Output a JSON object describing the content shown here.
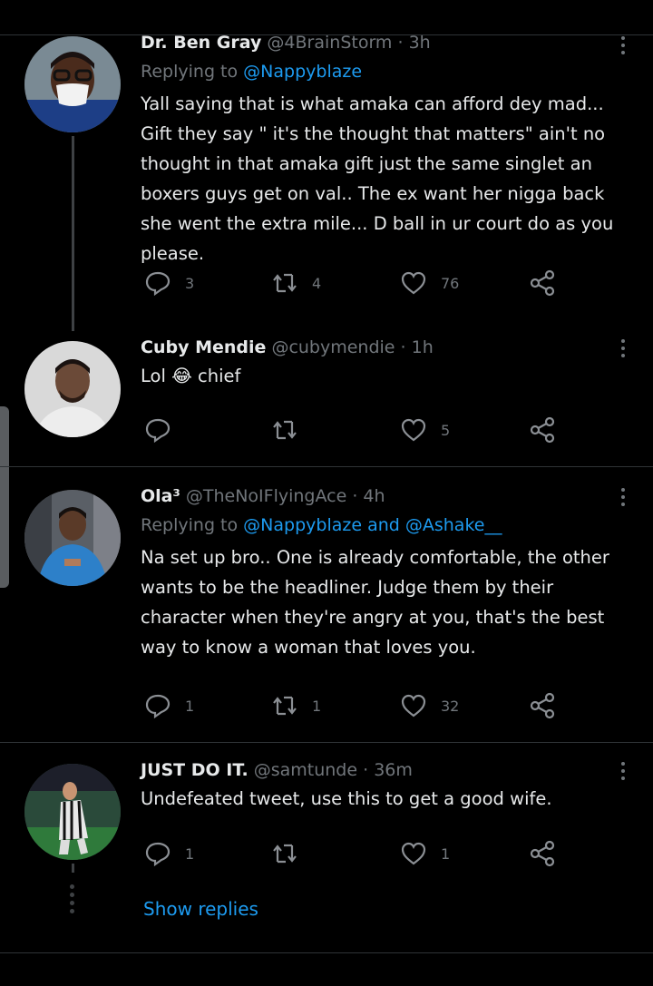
{
  "tweets": [
    {
      "name": "Dr. Ben Gray",
      "handle": "@4BrainStorm",
      "time": "3h",
      "replying_label": "Replying to",
      "mentions": "@Nappyblaze",
      "text": "Yall saying that is what amaka can afford dey mad... Gift they say \" it's the thought that matters\" ain't no thought in that amaka gift just the same singlet an boxers guys get on val.. The ex want her nigga back she went the extra mile... D ball in ur court do as you please.",
      "replies": "3",
      "retweets": "4",
      "likes": "76"
    },
    {
      "name": "Cuby Mendie",
      "handle": "@cubymendie",
      "time": "1h",
      "text": "Lol 😂 chief",
      "replies": "",
      "retweets": "",
      "likes": "5"
    },
    {
      "name": "Ola³",
      "handle": "@TheNoIFlyingAce",
      "time": "4h",
      "replying_label": "Replying to",
      "mentions": "@Nappyblaze and @Ashake__",
      "text": "Na set up bro.. One is already comfortable, the other wants to be the headliner. Judge them by their character when they're angry at you, that's the best way to know a woman that loves you.",
      "replies": "1",
      "retweets": "1",
      "likes": "32"
    },
    {
      "name": "JUST DO IT.",
      "handle": "@samtunde",
      "time": "36m",
      "text": "Undefeated tweet, use this to get a good wife.",
      "replies": "1",
      "retweets": "",
      "likes": "1"
    }
  ],
  "show_replies": "Show replies",
  "separator": "·",
  "icons": [
    "reply-icon",
    "retweet-icon",
    "like-icon",
    "share-icon",
    "more-icon"
  ],
  "colors": {
    "background": "#000000",
    "link": "#1d9bf0",
    "muted": "#71767b"
  }
}
